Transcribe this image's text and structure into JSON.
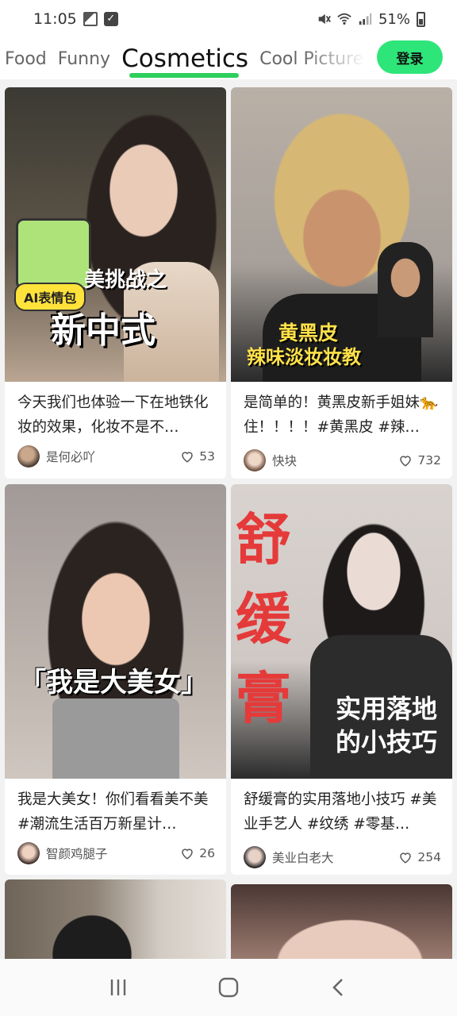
{
  "status_bar": {
    "time": "11:05",
    "battery": "51%"
  },
  "tabs": [
    {
      "label": "Food",
      "active": false
    },
    {
      "label": "Funny",
      "active": false
    },
    {
      "label": "Cosmetics",
      "active": true
    },
    {
      "label": "Cool Picture",
      "active": false
    }
  ],
  "login_button": {
    "label": "登录",
    "color": "#2ee57a"
  },
  "accent_color": "#2ecf5c",
  "cards": [
    {
      "title": "今天我们也体验一下在地铁化妆的效果，化妆不是不…",
      "author": "是何必吖",
      "likes": "53",
      "overlay": {
        "sticker": "AI表情包",
        "line1": "美挑战之",
        "line2": "新中式"
      }
    },
    {
      "title": "是简单的！黄黑皮新手姐妹🐆住！！！！#黄黑皮 #辣…",
      "author": "快块",
      "likes": "732",
      "overlay": {
        "line1": "黄黑皮",
        "line2": "辣味淡妆妆教"
      }
    },
    {
      "title": "我是大美女！你们看看美不美 #潮流生活百万新星计…",
      "author": "智颜鸡腿子",
      "likes": "26",
      "overlay": {
        "line1": "「我是大美女」"
      }
    },
    {
      "title": "舒缓膏的实用落地小技巧 #美业手艺人 #纹绣 #零基…",
      "author": "美业白老大",
      "likes": "254",
      "overlay": {
        "vertical": "舒缓膏",
        "line1": "实用落地",
        "line2": "的小技巧"
      }
    }
  ]
}
